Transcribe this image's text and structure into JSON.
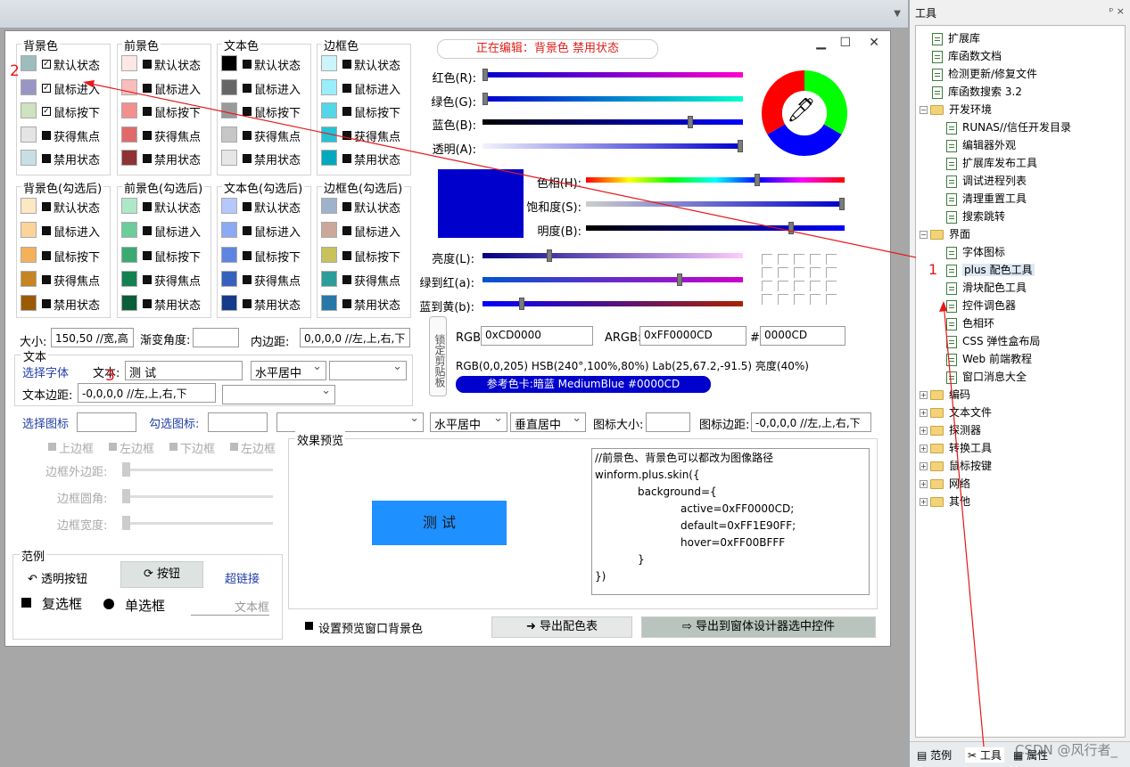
{
  "tools_panel": {
    "title": "工具",
    "pin_icons": "ᵖ ×",
    "tree_top": [
      "扩展库",
      "库函数文档",
      "检测更新/修复文件",
      "库函数搜索 3.2"
    ],
    "dev_env": {
      "label": "开发环境",
      "items": [
        "RUNAS//信任开发目录",
        "编辑器外观",
        "扩展库发布工具",
        "调试进程列表",
        "清理重置工具",
        "搜索跳转"
      ]
    },
    "ui": {
      "label": "界面",
      "items": [
        "字体图标",
        "plus 配色工具",
        "滑块配色工具",
        "控件调色器",
        "色相环",
        "CSS 弹性盒布局",
        "Web 前端教程",
        "窗口消息大全"
      ]
    },
    "collapsed": [
      "编码",
      "文本文件",
      "探测器",
      "转换工具",
      "鼠标按键",
      "网络",
      "其他"
    ],
    "tabs": [
      "范例",
      "工具",
      "属性"
    ],
    "watermark": "CSDN @风行者_"
  },
  "window": {
    "editing_label": "正在编辑：背景色 禁用状态",
    "states": [
      "默认状态",
      "鼠标进入",
      "鼠标按下",
      "获得焦点",
      "禁用状态"
    ],
    "groups_top": [
      {
        "title": "背景色",
        "colors": [
          "#9dbcbc",
          "#9a96c4",
          "#cde2bf",
          "#e4e4e4",
          "#c7dfe4"
        ],
        "checked": [
          true,
          true,
          true,
          false,
          false
        ]
      },
      {
        "title": "前景色",
        "colors": [
          "#fde6e6",
          "#fbbcbc",
          "#f48f8f",
          "#e06a6a",
          "#8e3434"
        ],
        "checked": [
          false,
          false,
          false,
          false,
          false
        ]
      },
      {
        "title": "文本色",
        "colors": [
          "#000000",
          "#666666",
          "#9a9a9a",
          "#c6c6c6",
          "#e6e6e6"
        ],
        "checked": [
          false,
          false,
          false,
          false,
          false
        ]
      },
      {
        "title": "边框色",
        "colors": [
          "#cbf4fb",
          "#99eefb",
          "#53d7e8",
          "#25c2d5",
          "#00a9bd"
        ],
        "checked": [
          false,
          false,
          false,
          false,
          false
        ]
      }
    ],
    "groups_bottom": [
      {
        "title": "背景色(勾选后)",
        "colors": [
          "#fde8c4",
          "#fcd49a",
          "#f5b15a",
          "#c68423",
          "#9a5b06"
        ]
      },
      {
        "title": "前景色(勾选后)",
        "colors": [
          "#aee8c8",
          "#6ccc9a",
          "#3aaa72",
          "#138050",
          "#0b5e3a"
        ]
      },
      {
        "title": "文本色(勾选后)",
        "colors": [
          "#b5c8fb",
          "#8caaf3",
          "#5e86e0",
          "#3662bd",
          "#153c8a"
        ]
      },
      {
        "title": "边框色(勾选后)",
        "colors": [
          "#9eb2cc",
          "#cba897",
          "#c9c25a",
          "#2c9e9a",
          "#2778a8"
        ]
      }
    ],
    "size": {
      "label": "大小:",
      "value": "150,50 //宽,高"
    },
    "gradient_angle": {
      "label": "渐变角度:",
      "value": ""
    },
    "padding": {
      "label": "内边距:",
      "value": "0,0,0,0  //左,上,右,下"
    },
    "text_section": {
      "title": "文本",
      "choose_font": "选择字体",
      "text_label": "文本:",
      "text_value": "测 试",
      "h_align": "水平居中",
      "margin_label": "文本边距:",
      "margin_value": "-0,0,0,0 //左,上,右,下"
    },
    "lock_button": "锁定剪贴板",
    "icon_row": {
      "choose_icon": "选择图标",
      "checked_icon": "勾选图标:",
      "h_align": "水平居中",
      "v_align": "垂直居中",
      "icon_size_label": "图标大小:",
      "icon_margin_label": "图标边距:",
      "icon_margin_value": "-0,0,0,0 //左,上,右,下"
    },
    "border_checks": [
      "上边框",
      "左边框",
      "下边框",
      "左边框"
    ],
    "border_sliders": [
      "边框外边距:",
      "边框圆角:",
      "边框宽度:"
    ],
    "sample": {
      "title": "范例",
      "transparent_button": "透明按钮",
      "button": "按钮",
      "hyperlink": "超链接",
      "checkbox": "复选框",
      "radio": "单选框",
      "textbox_placeholder": "文本框"
    },
    "preview": {
      "title": "效果预览",
      "button_text": "测 试",
      "code": [
        "//前景色、背景色可以都改为图像路径",
        "winform.plus.skin({",
        "    background={",
        "        active=0xFF0000CD;",
        "        default=0xFF1E90FF;",
        "        hover=0xFF00BFFF",
        "    }",
        "})"
      ]
    },
    "set_preview_bg": "设置预览窗口背景色",
    "export_table": "导出配色表",
    "export_to_designer": "导出到窗体设计器选中控件",
    "rgb_sliders": {
      "labels": [
        "红色(R):",
        "绿色(G):",
        "蓝色(B):",
        "透明(A):"
      ],
      "values": [
        0,
        0,
        205,
        255
      ]
    },
    "hsb_sliders": {
      "labels": [
        "色相(H):",
        "饱和度(S):",
        "明度(B):"
      ],
      "values": [
        240,
        100,
        80
      ]
    },
    "lab_sliders": {
      "labels": [
        "亮度(L):",
        "绿到红(a):",
        "蓝到黄(b):"
      ],
      "values": [
        25,
        67.2,
        -91.5
      ]
    },
    "current_color": "#0000CD",
    "rgb_label": "RGB:",
    "rgb_value": "0xCD0000",
    "argb_label": "ARGB:",
    "argb_value": "0xFF0000CD",
    "hash_label": "#",
    "hex_value": "0000CD",
    "info_line": "RGB(0,0,205) HSB(240°,100%,80%) Lab(25,67.2,-91.5) 亮度(40%)",
    "ref_card": "参考色卡:暗蓝 MediumBlue  #0000CD"
  },
  "annotations": {
    "one": "1",
    "two": "2",
    "three": "3"
  }
}
